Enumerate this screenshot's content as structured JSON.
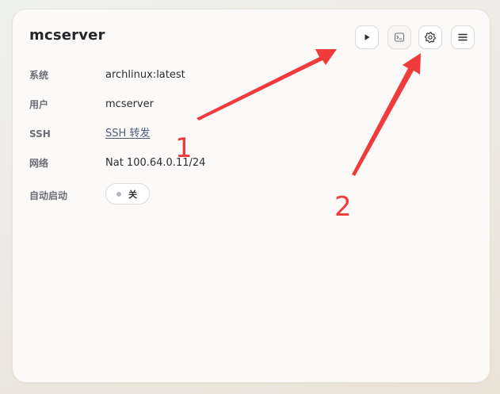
{
  "server": {
    "name": "mcserver"
  },
  "toolbar": {
    "buttons": [
      {
        "name": "start-button",
        "icon": "play-icon"
      },
      {
        "name": "console-button",
        "icon": "terminal-icon"
      },
      {
        "name": "settings-button",
        "icon": "gear-icon"
      },
      {
        "name": "menu-button",
        "icon": "hamburger-menu-icon"
      }
    ]
  },
  "details": {
    "system": {
      "label": "系统",
      "value": "archlinux:latest"
    },
    "user": {
      "label": "用户",
      "value": "mcserver"
    },
    "ssh": {
      "label": "SSH",
      "value": "SSH 转发"
    },
    "network": {
      "label": "网络",
      "value": "Nat 100.64.0.11/24"
    },
    "autostart": {
      "label": "自动启动",
      "toggle_label": "关",
      "enabled": false
    }
  },
  "annotations": {
    "one": "1",
    "two": "2",
    "color": "#ef3b3b"
  },
  "colors": {
    "card_bg": "#fbfaf9",
    "title": "#25272b",
    "label": "#6b6e75",
    "link": "#4d5a78"
  }
}
